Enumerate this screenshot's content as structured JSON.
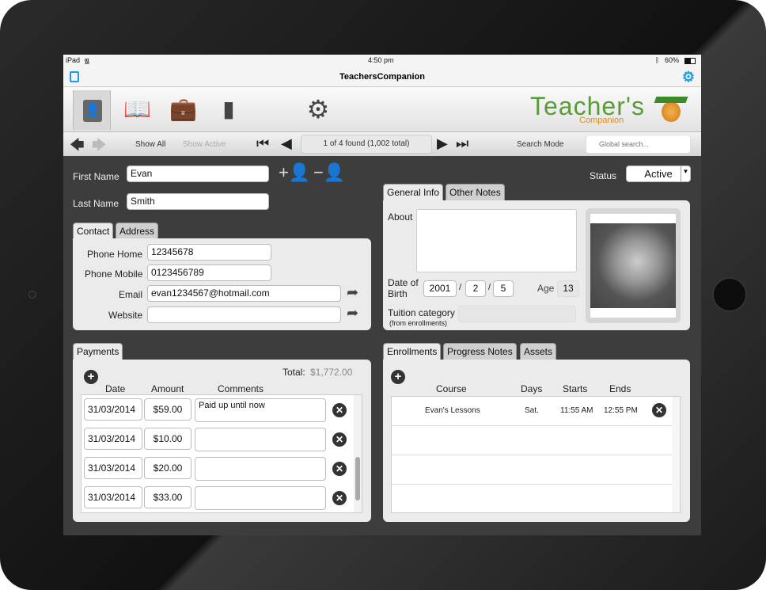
{
  "statusbar": {
    "device": "iPad",
    "time": "4:50 pm",
    "battery": "60%"
  },
  "titlebar": {
    "title": "TeachersCompanion"
  },
  "logo": {
    "text": "Teacher's",
    "sub": "Companion"
  },
  "navbar": {
    "show_all": "Show All",
    "show_active": "Show Active",
    "record_info": "1 of 4 found (1,002 total)",
    "search_mode": "Search Mode",
    "search_placeholder": "Global search..."
  },
  "student": {
    "first_name_label": "First Name",
    "first_name": "Evan",
    "last_name_label": "Last Name",
    "last_name": "Smith",
    "status_label": "Status",
    "status": "Active"
  },
  "contact": {
    "tabs": [
      "Contact",
      "Address"
    ],
    "phone_home_label": "Phone Home",
    "phone_home": "12345678",
    "phone_mobile_label": "Phone Mobile",
    "phone_mobile": "0123456789",
    "email_label": "Email",
    "email": "evan1234567@hotmail.com",
    "website_label": "Website",
    "website": ""
  },
  "general": {
    "tabs": [
      "General Info",
      "Other Notes"
    ],
    "about_label": "About",
    "about": "",
    "dob_label": "Date of Birth",
    "dob_year": "2001",
    "dob_month": "2",
    "dob_day": "5",
    "age_label": "Age",
    "age": "13",
    "tuition_label": "Tuition category",
    "tuition_sub": "(from enrollments)",
    "tuition": ""
  },
  "payments": {
    "tab": "Payments",
    "total_label": "Total:",
    "total": "$1,772.00",
    "headers": [
      "Date",
      "Amount",
      "Comments"
    ],
    "rows": [
      {
        "date": "31/03/2014",
        "amount": "$59.00",
        "comment": "Paid up until now"
      },
      {
        "date": "31/03/2014",
        "amount": "$10.00",
        "comment": ""
      },
      {
        "date": "31/03/2014",
        "amount": "$20.00",
        "comment": ""
      },
      {
        "date": "31/03/2014",
        "amount": "$33.00",
        "comment": ""
      }
    ]
  },
  "enrollments": {
    "tabs": [
      "Enrollments",
      "Progress Notes",
      "Assets"
    ],
    "headers": [
      "Course",
      "Days",
      "Starts",
      "Ends"
    ],
    "rows": [
      {
        "course": "Evan's Lessons",
        "days": "Sat.",
        "starts": "11:55 AM",
        "ends": "12:55 PM"
      }
    ]
  },
  "colors": {
    "accent": "#1a9be6",
    "logo_green": "#5a9a3a",
    "logo_orange": "#e08a1e",
    "content_bg": "#3d3d3d"
  }
}
